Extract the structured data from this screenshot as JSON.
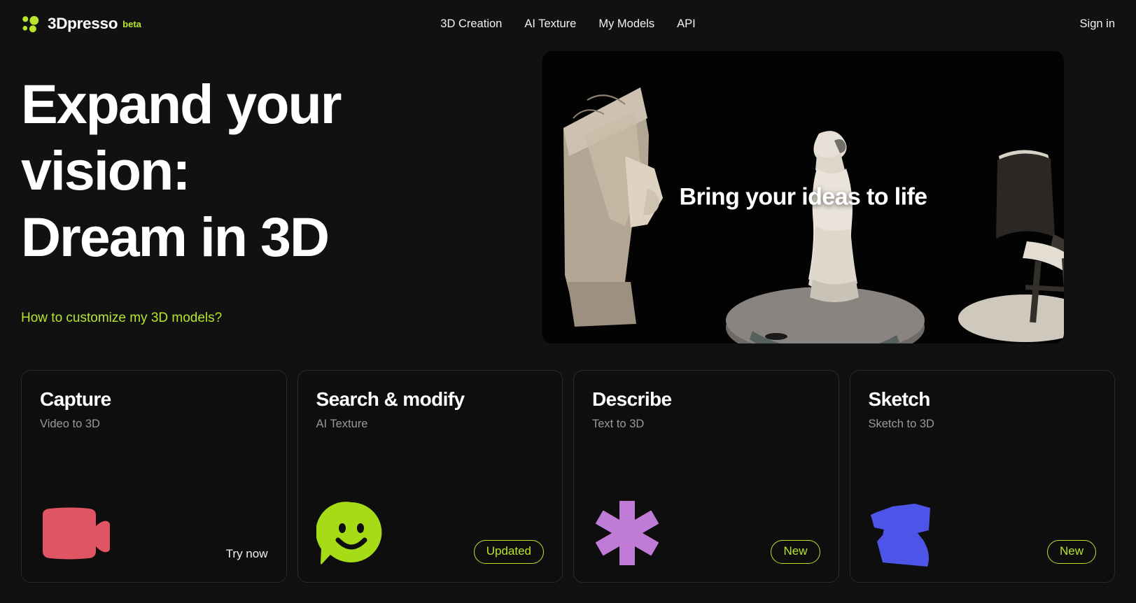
{
  "header": {
    "logo_icon": "dots-cluster-logo-icon",
    "brand": "3Dpresso",
    "beta": "beta",
    "nav": [
      {
        "label": "3D Creation",
        "name": "nav-item-3d-creation"
      },
      {
        "label": "AI Texture",
        "name": "nav-item-ai-texture"
      },
      {
        "label": "My Models",
        "name": "nav-item-my-models"
      },
      {
        "label": "API",
        "name": "nav-item-api"
      }
    ],
    "signin": "Sign in"
  },
  "hero": {
    "headline": "Expand your\nvision:\nDream in 3D",
    "link": "How to customize my 3D models?",
    "media_caption": "Bring your ideas to life",
    "media_alt": "3D scanned objects: Nefertiti bust, Venus statue on disc, chair"
  },
  "cards": [
    {
      "title": "Capture",
      "subtitle": "Video to 3D",
      "icon": "video-camera-icon",
      "icon_color": "#e05563",
      "action": "Try now",
      "badge": null
    },
    {
      "title": "Search & modify",
      "subtitle": "AI Texture",
      "icon": "smiley-speech-bubble-icon",
      "icon_color": "#a5dc16",
      "action": null,
      "badge": "Updated"
    },
    {
      "title": "Describe",
      "subtitle": "Text to 3D",
      "icon": "asterisk-icon",
      "icon_color": "#c07bd6",
      "action": null,
      "badge": "New"
    },
    {
      "title": "Sketch",
      "subtitle": "Sketch to 3D",
      "icon": "sketch-blob-icon",
      "icon_color": "#4d55e8",
      "action": null,
      "badge": "New"
    }
  ],
  "colors": {
    "background": "#111111",
    "accent_green": "#b8e62b",
    "card_bg": "#0e0e0e",
    "card_border": "#2a2a2a",
    "text_primary": "#ffffff",
    "text_muted": "#9a9a9a"
  }
}
